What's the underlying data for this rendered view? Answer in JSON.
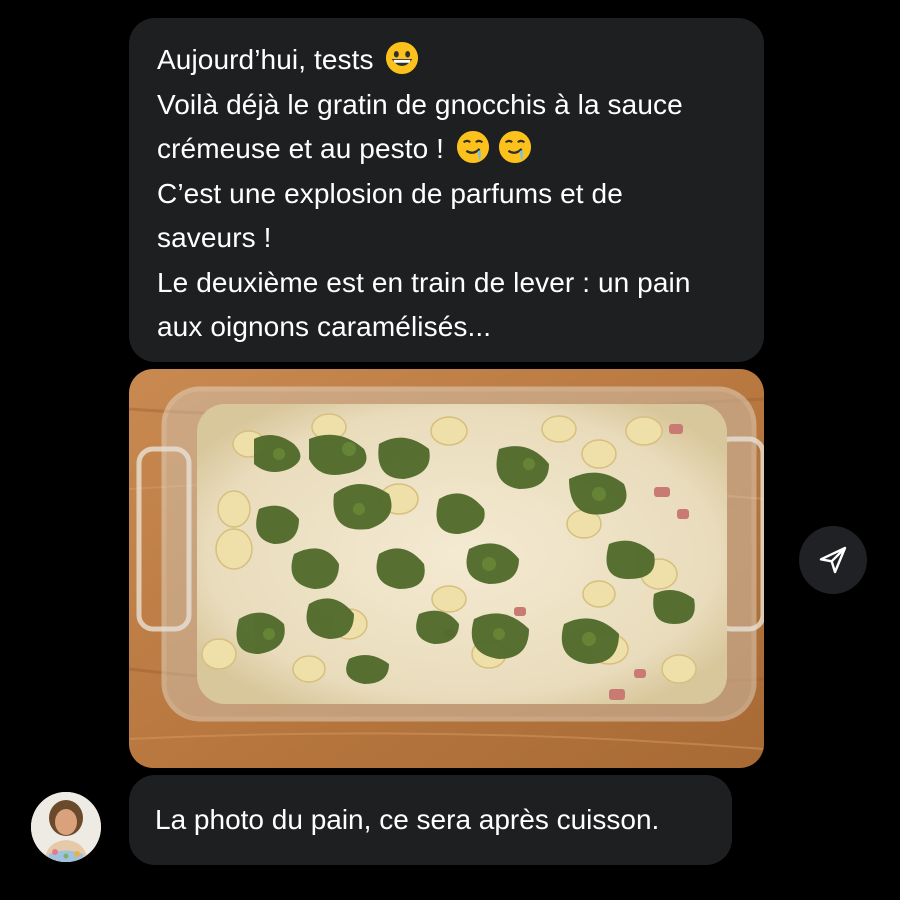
{
  "messages": {
    "first": {
      "lines": [
        "Aujourd’hui, tests",
        "Voilà déjà le gratin de gnocchis à la sauce",
        "crémeuse et au pesto !",
        "C’est une explosion de parfums et de",
        "saveurs !",
        "Le deuxième est en train de lever : un pain",
        "aux oignons caramélisés..."
      ],
      "emoji_line0": "grinning-face-emoji",
      "emoji_line2": [
        "drooling-face-emoji",
        "drooling-face-emoji"
      ]
    },
    "photo": {
      "subject": "gnocchi-gratin-with-pesto-in-glass-dish"
    },
    "last": {
      "text": "La photo du pain, ce sera après cuisson."
    }
  },
  "actions": {
    "share_icon": "send-arrow-icon"
  },
  "sender": {
    "avatar_icon": "avatar"
  },
  "colors": {
    "background": "#000000",
    "bubble": "#1e1f21",
    "text": "#ffffff",
    "share_button": "#202124"
  }
}
